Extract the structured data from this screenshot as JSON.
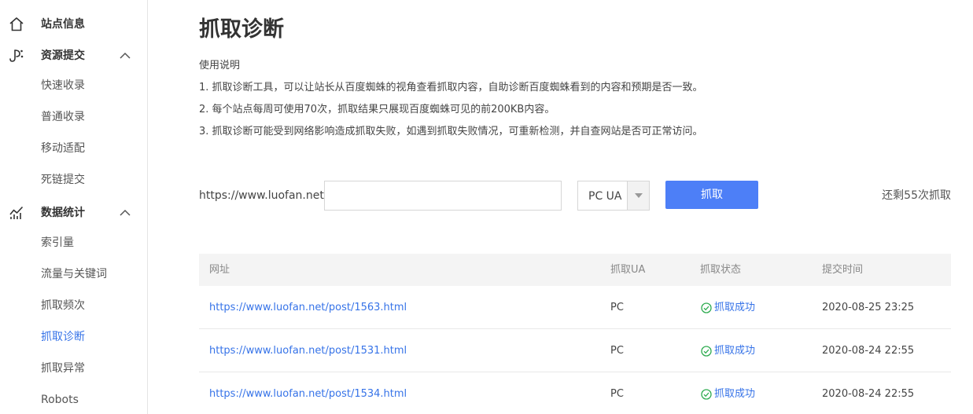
{
  "sidebar": {
    "groups": [
      {
        "label": "站点信息",
        "icon": "home-icon"
      },
      {
        "label": "资源提交",
        "icon": "resource-submit-icon",
        "items": [
          "快速收录",
          "普通收录",
          "移动适配",
          "死链提交"
        ]
      },
      {
        "label": "数据统计",
        "icon": "stats-icon",
        "items": [
          "索引量",
          "流量与关键词",
          "抓取频次",
          "抓取诊断",
          "抓取异常",
          "Robots"
        ]
      }
    ],
    "active_item": "抓取诊断"
  },
  "main": {
    "title": "抓取诊断",
    "usage_title": "使用说明",
    "usage_lines": [
      "1. 抓取诊断工具，可以让站长从百度蜘蛛的视角查看抓取内容，自助诊断百度蜘蛛看到的内容和预期是否一致。",
      "2. 每个站点每周可使用70次，抓取结果只展现百度蜘蛛可见的前200KB内容。",
      "3. 抓取诊断可能受到网络影响造成抓取失败，如遇到抓取失败情况，可重新检测，并自查网站是否可正常访问。"
    ],
    "form": {
      "url_prefix": "https://www.luofan.net/",
      "url_value": "",
      "ua_selected": "PC UA",
      "submit_label": "抓取",
      "remaining_text": "还剩55次抓取"
    },
    "table": {
      "headers": [
        "网址",
        "抓取UA",
        "抓取状态",
        "提交时间"
      ],
      "rows": [
        {
          "url": "https://www.luofan.net/post/1563.html",
          "ua": "PC",
          "status": "抓取成功",
          "time": "2020-08-25 23:25"
        },
        {
          "url": "https://www.luofan.net/post/1531.html",
          "ua": "PC",
          "status": "抓取成功",
          "time": "2020-08-24 22:55"
        },
        {
          "url": "https://www.luofan.net/post/1534.html",
          "ua": "PC",
          "status": "抓取成功",
          "time": "2020-08-24 22:55"
        }
      ]
    }
  },
  "colors": {
    "accent": "#3673e8",
    "button": "#4d7ff7",
    "success": "#2dab4f"
  }
}
